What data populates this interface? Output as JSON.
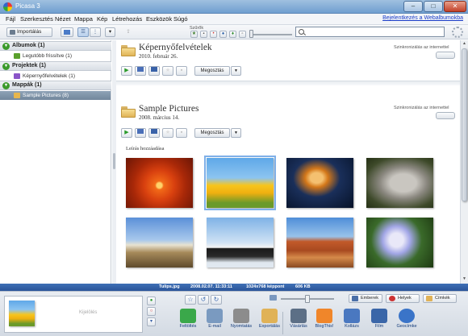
{
  "window": {
    "title": "Picasa 3",
    "minimize": "–",
    "maximize": "□",
    "close": "✕"
  },
  "menu": {
    "items": [
      "Fájl",
      "Szerkesztés",
      "Nézet",
      "Mappa",
      "Kép",
      "Létrehozás",
      "Eszközök",
      "Súgó"
    ],
    "signin": "Bejelentkezés a Webalbumokba"
  },
  "toolbar": {
    "import_label": "Importálás",
    "filters_label": "Szűrők",
    "search_value": "",
    "search_placeholder": ""
  },
  "sidebar": {
    "groups": [
      {
        "label": "Albumok (1)",
        "items": [
          {
            "label": "Legutóbb frissítve (1)",
            "icon": "recent-album-icon",
            "color": "#5aa02c"
          }
        ]
      },
      {
        "label": "Projektek (1)",
        "items": [
          {
            "label": "Képernyőfelvételek (1)",
            "icon": "screenshots-project-icon",
            "color": "#8a55c8"
          }
        ]
      },
      {
        "label": "Mappák (1)",
        "items": [
          {
            "label": "Sample Pictures (8)",
            "icon": "folder-icon",
            "color": "#e7b64c",
            "selected": true
          }
        ]
      }
    ]
  },
  "albums": [
    {
      "title": "Képernyőfelvételek",
      "date": "2010. február 26.",
      "sync_label": "Szinkronizálás az internettel",
      "share_label": "Megosztás"
    },
    {
      "title": "Sample Pictures",
      "date": "2008. március 14.",
      "sync_label": "Szinkronizálás az internettel",
      "share_label": "Megosztás",
      "caption": "Leírás hozzáadása",
      "thumbnails": [
        {
          "name": "chrysanthemum",
          "selected": false
        },
        {
          "name": "tulips",
          "selected": true
        },
        {
          "name": "jellyfish",
          "selected": false
        },
        {
          "name": "koala",
          "selected": false
        },
        {
          "name": "lighthouse",
          "selected": false
        },
        {
          "name": "penguins",
          "selected": false
        },
        {
          "name": "desert",
          "selected": false
        },
        {
          "name": "hydrangeas",
          "selected": false
        }
      ]
    }
  ],
  "infobar": {
    "filename": "Tulips.jpg",
    "datetime": "2008.02.07. 11:33:11",
    "dimensions": "1024x768 képpont",
    "filesize": "606 KB"
  },
  "bottom": {
    "hold_label": "Kijelölés",
    "people_label": "Emberek",
    "places_label": "Helyek",
    "tags_label": "Címkék",
    "actions": [
      {
        "label": "Feltöltés",
        "icon": "upload-icon",
        "color": "#3aa84a"
      },
      {
        "label": "E-mail",
        "icon": "email-icon",
        "color": "#7a9ac0"
      },
      {
        "label": "Nyomtatás",
        "icon": "print-icon",
        "color": "#8c8c8c"
      },
      {
        "label": "Exportálás",
        "icon": "export-icon",
        "color": "#e0b257"
      },
      {
        "label": "Vásárlás",
        "icon": "shop-icon",
        "color": "#5c6f86"
      },
      {
        "label": "BlogThis!",
        "icon": "blogger-icon",
        "color": "#f0862a"
      },
      {
        "label": "Kollázs",
        "icon": "collage-icon",
        "color": "#4a78c0"
      },
      {
        "label": "Film",
        "icon": "movie-icon",
        "color": "#3a66a8"
      },
      {
        "label": "Geocímke",
        "icon": "geotag-icon",
        "color": "#3a74c8"
      }
    ]
  }
}
